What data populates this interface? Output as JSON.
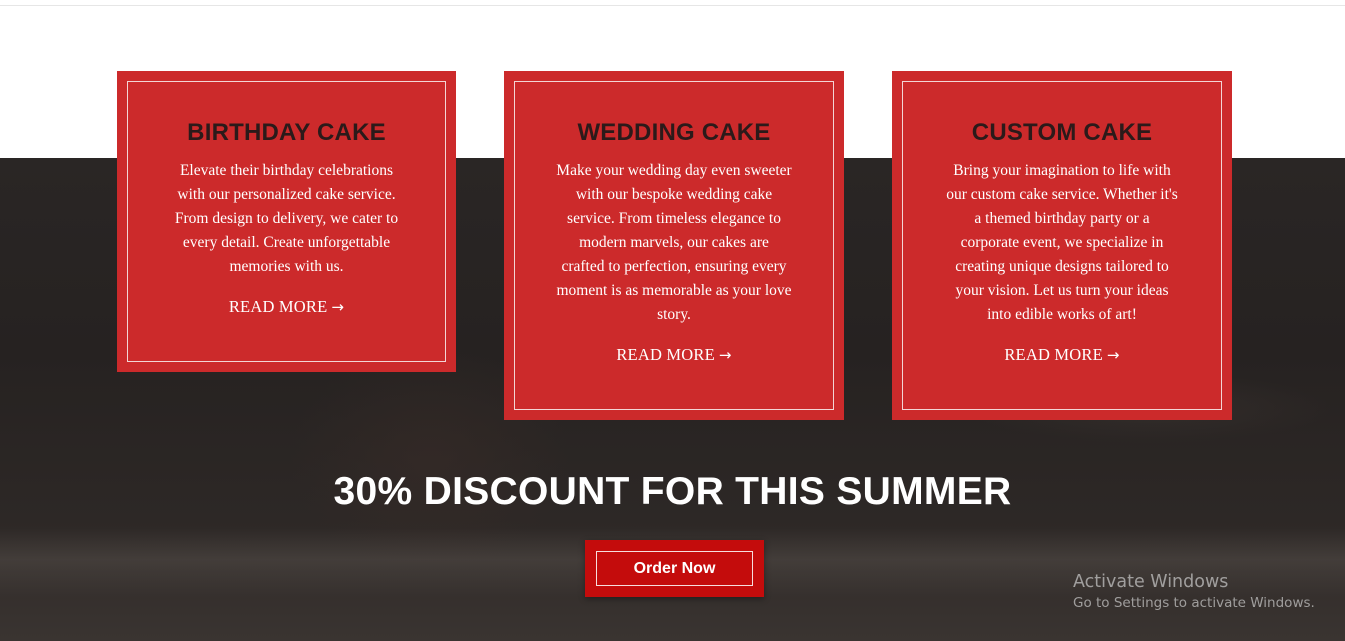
{
  "cards": [
    {
      "title": "BIRTHDAY CAKE",
      "lines": [
        "Elevate their birthday celebrations",
        "with our personalized cake service.",
        "From design to delivery, we cater to",
        "every detail. Create unforgettable",
        "memories with us."
      ],
      "link_label": "READ MORE",
      "link_icon": "arrow-right-icon"
    },
    {
      "title": "WEDDING CAKE",
      "lines": [
        "Make your wedding day even sweeter",
        "with our bespoke wedding cake",
        "service. From timeless elegance to",
        "modern marvels, our cakes are",
        "crafted to perfection, ensuring every",
        "moment is as memorable as your love",
        "story."
      ],
      "link_label": "READ MORE",
      "link_icon": "arrow-right-icon"
    },
    {
      "title": "CUSTOM CAKE",
      "lines": [
        "Bring your imagination to life with",
        "our custom cake service. Whether it's",
        "a themed birthday party or a",
        "corporate event, we specialize in",
        "creating unique designs tailored to",
        "your vision. Let us turn your ideas",
        "into edible works of art!"
      ],
      "link_label": "READ MORE",
      "link_icon": "arrow-right-icon"
    }
  ],
  "promo": {
    "title": "30% DISCOUNT FOR THIS SUMMER",
    "button_label": "Order Now"
  },
  "watermark": {
    "title": "Activate Windows",
    "subtitle": "Go to Settings to activate Windows."
  },
  "colors": {
    "card_background": "#cc2a2b",
    "card_title": "#2b1a1a",
    "button_background": "#c40c0c",
    "dark_background": "#2a2625"
  }
}
